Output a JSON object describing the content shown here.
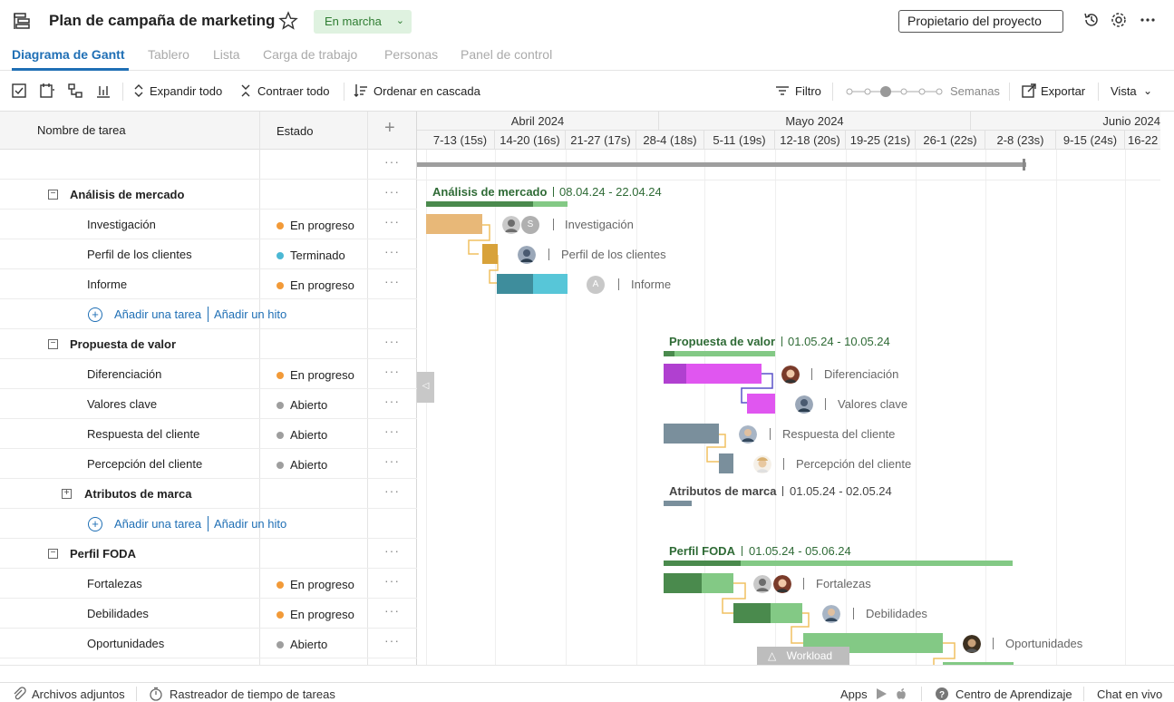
{
  "header": {
    "title": "Plan de campaña de marketing",
    "status": "En marcha",
    "owner_button": "Propietario del proyecto"
  },
  "tabs": [
    "Diagrama de Gantt",
    "Tablero",
    "Lista",
    "Carga de trabajo",
    "Personas",
    "Panel de control"
  ],
  "toolbar": {
    "expand_all": "Expandir todo",
    "collapse_all": "Contraer todo",
    "cascade": "Ordenar en cascada",
    "filter": "Filtro",
    "zoom_label": "Semanas",
    "export": "Exportar",
    "view": "Vista"
  },
  "grid": {
    "col_task": "Nombre de tarea",
    "col_status": "Estado",
    "add_task": "Añadir una tarea",
    "add_milestone": "Añadir un hito"
  },
  "rows": {
    "g1": "Análisis de mercado",
    "t1": "Investigación",
    "s1": "En progreso",
    "t2": "Perfil de los clientes",
    "s2": "Terminado",
    "t3": "Informe",
    "s3": "En progreso",
    "g2": "Propuesta de valor",
    "t4": "Diferenciación",
    "s4": "En progreso",
    "t5": "Valores clave",
    "s5": "Abierto",
    "t6": "Respuesta del cliente",
    "s6": "Abierto",
    "t7": "Percepción del cliente",
    "s7": "Abierto",
    "g3": "Atributos de marca",
    "g4": "Perfil FODA",
    "t8": "Fortalezas",
    "s8": "En progreso",
    "t9": "Debilidades",
    "s9": "En progreso",
    "t10": "Oportunidades",
    "s10": "Abierto"
  },
  "status_colors": {
    "En progreso": "#f29a38",
    "Terminado": "#4bb8d4",
    "Abierto": "#9e9e9e"
  },
  "timeline": {
    "months": [
      "Abril 2024",
      "Mayo 2024",
      "Junio 2024"
    ],
    "weeks": [
      "7-13 (15s)",
      "14-20 (16s)",
      "21-27 (17s)",
      "28-4 (18s)",
      "5-11 (19s)",
      "12-18 (20s)",
      "19-25 (21s)",
      "26-1 (22s)",
      "2-8 (23s)",
      "9-15 (24s)",
      "16-22"
    ]
  },
  "chart": {
    "g1_label": "Análisis de mercado",
    "g1_dates": "08.04.24 - 22.04.24",
    "g2_label": "Propuesta de valor",
    "g2_dates": "01.05.24 - 10.05.24",
    "g3_label": "Atributos de marca",
    "g3_dates": "01.05.24 - 02.05.24",
    "g4_label": "Perfil FODA",
    "g4_dates": "01.05.24 - 05.06.24",
    "l1": "Investigación",
    "l2": "Perfil de los clientes",
    "l3": "Informe",
    "l4": "Diferenciación",
    "l5": "Valores clave",
    "l6": "Respuesta del cliente",
    "l7": "Percepción del cliente",
    "l8": "Fortalezas",
    "l9": "Debilidades",
    "l10": "Oportunidades",
    "avatar_s": "S",
    "avatar_a": "A",
    "workload": "Workload"
  },
  "footer": {
    "attachments": "Archivos adjuntos",
    "timer": "Rastreador de tiempo de tareas",
    "apps": "Apps",
    "learning": "Centro de Aprendizaje",
    "chat": "Chat en vivo"
  }
}
